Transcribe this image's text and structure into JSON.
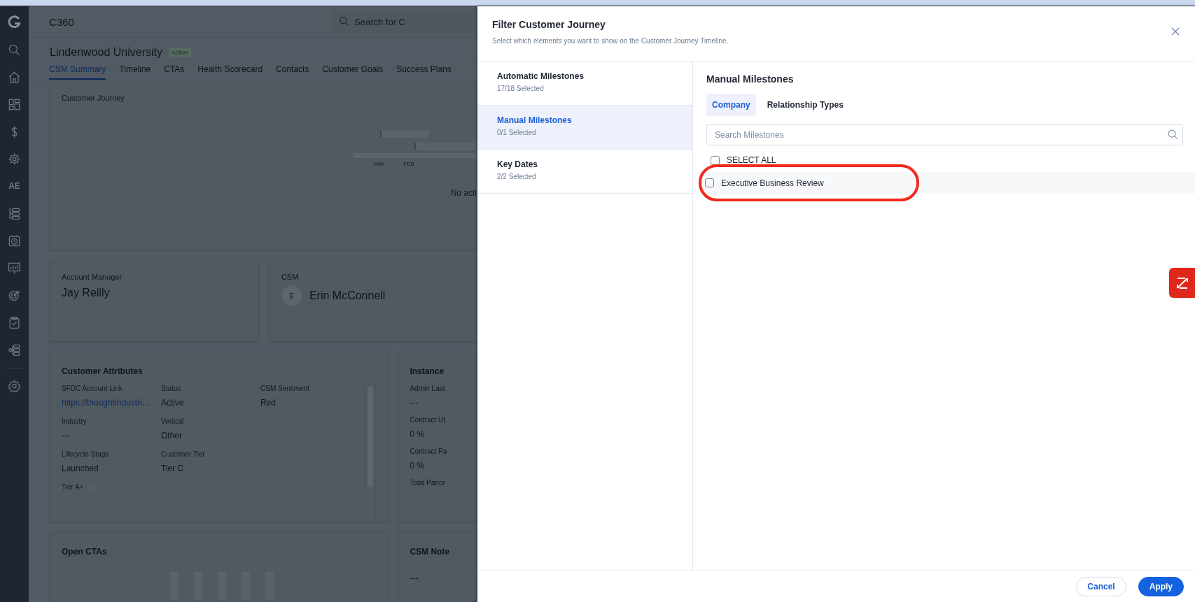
{
  "sidebar": {
    "label": "AE"
  },
  "app": {
    "title": "C360",
    "search_placeholder": "Search for C",
    "account": {
      "name": "Lindenwood University",
      "status": "Active"
    },
    "tabs": [
      {
        "label": "CSM Summary",
        "selected": true
      },
      {
        "label": "Timeline",
        "selected": false
      },
      {
        "label": "CTAs",
        "selected": false
      },
      {
        "label": "Health Scorecard",
        "selected": false
      },
      {
        "label": "Contacts",
        "selected": false
      },
      {
        "label": "Customer Goals",
        "selected": false
      },
      {
        "label": "Success Plans",
        "selected": false
      }
    ],
    "journey": {
      "title": "Customer Journey",
      "months": [
        "JAN",
        "FEB"
      ],
      "empty_text": "No acti"
    },
    "account_manager": {
      "label": "Account Manager",
      "name": "Jay Reilly"
    },
    "csm": {
      "label": "CSM",
      "initial": "E",
      "name": "Erin McConnell"
    },
    "customer_attributes": {
      "title": "Customer Attributes",
      "rows": [
        [
          {
            "label": "SFDC Account Link",
            "value": "https://thoughtindustri…",
            "kind": "link"
          },
          {
            "label": "Status",
            "value": "Active",
            "kind": "text"
          },
          {
            "label": "CSM Sentiment",
            "value": "Red",
            "kind": "text"
          }
        ],
        [
          {
            "label": "Industry",
            "value": "---",
            "kind": "text"
          },
          {
            "label": "Vertical",
            "value": "Other",
            "kind": "text"
          }
        ],
        [
          {
            "label": "Lifecycle Stage",
            "value": "Launched",
            "kind": "text"
          },
          {
            "label": "Customer Tier",
            "value": "Tier C",
            "kind": "text"
          }
        ]
      ],
      "cut_label": "Tier A+"
    },
    "instance": {
      "title": "Instance",
      "fields": [
        {
          "label": "Admin Last",
          "value": "---"
        },
        {
          "label": "Contract Ut",
          "value": "0 %"
        },
        {
          "label": "Contract Pa",
          "value": "0 %"
        }
      ],
      "cut_label": "Total Panor"
    },
    "open_ctas": {
      "title": "Open CTAs"
    },
    "csm_notes": {
      "title": "CSM Note",
      "value": "---"
    }
  },
  "modal": {
    "title": "Filter Customer Journey",
    "subtitle": "Select which elements you want to show on the Customer Journey Timeline.",
    "sections": [
      {
        "name": "Automatic Milestones",
        "count": "17/18 Selected",
        "selected": false
      },
      {
        "name": "Manual Milestones",
        "count": "0/1 Selected",
        "selected": true
      },
      {
        "name": "Key Dates",
        "count": "2/2 Selected",
        "selected": false
      }
    ],
    "panel_title": "Manual Milestones",
    "tabs": [
      {
        "label": "Company",
        "selected": true
      },
      {
        "label": "Relationship Types",
        "selected": false
      }
    ],
    "search_placeholder": "Search Milestones",
    "select_all": {
      "label": "SELECT ALL",
      "checked": false
    },
    "milestones": [
      {
        "label": "Executive Business Review",
        "checked": false,
        "highlighted": true
      }
    ],
    "buttons": [
      {
        "label": "Cancel",
        "kind": "secondary"
      },
      {
        "label": "Apply",
        "kind": "primary"
      }
    ]
  }
}
